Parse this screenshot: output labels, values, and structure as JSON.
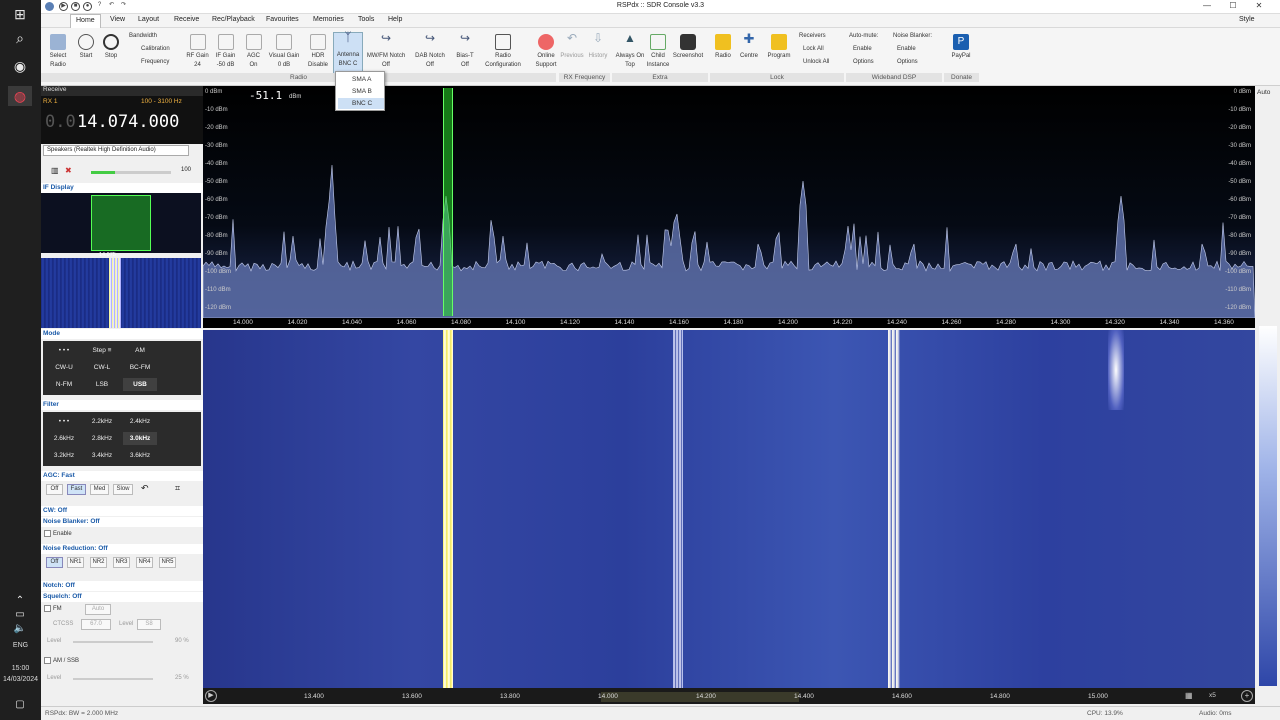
{
  "taskbar": {
    "lang": "ENG",
    "time": "15:00",
    "date": "14/03/2024"
  },
  "window": {
    "title": "RSPdx :: SDR Console v3.3",
    "style_label": "Style"
  },
  "menu": [
    "Home",
    "View",
    "Layout",
    "Receive",
    "Rec/Playback",
    "Favourites",
    "Memories",
    "Tools",
    "Help"
  ],
  "ribbon": {
    "select_radio": "Select Radio",
    "start": "Start",
    "stop": "Stop",
    "bandwidth": "Bandwidth",
    "calibration": "Calibration",
    "frequency": "Frequency",
    "rf_gain": "RF Gain",
    "rf_gain_val": "24",
    "if_gain": "IF Gain",
    "if_gain_val": "-50 dB",
    "agc": "AGC",
    "agc_val": "On",
    "visual_gain": "Visual Gain",
    "visual_gain_val": "0 dB",
    "hdr": "HDR",
    "hdr_val": "Disable",
    "antenna": "Antenna",
    "antenna_val": "BNC C",
    "mwfm_notch": "MW/FM Notch",
    "mwfm_val": "Off",
    "dab_notch": "DAB Notch",
    "dab_val": "Off",
    "bias_t": "Bias-T",
    "bias_val": "Off",
    "radio_config": "Radio Configuration",
    "online_support": "Online Support",
    "previous": "Previous",
    "history": "History",
    "always_on_top": "Always On Top",
    "child_instance": "Child Instance",
    "screenshot": "Screenshot",
    "lock_radio": "Radio",
    "lock_centre": "Centre",
    "lock_program": "Program",
    "receivers": "Receivers",
    "lock_all": "Lock All",
    "unlock_all": "Unlock All",
    "automute": "Auto-mute:",
    "automute_enable": "Enable",
    "automute_options": "Options",
    "noise_blanker": "Noise Blanker:",
    "nb_enable": "Enable",
    "nb_options": "Options",
    "paypal": "PayPal",
    "groups": [
      "Radio",
      "RX Frequency",
      "Extra",
      "Lock",
      "Wideband DSP",
      "Donate"
    ]
  },
  "antenna_dropdown": {
    "items": [
      "SMA A",
      "SMA B",
      "BNC C"
    ],
    "selected": "BNC C"
  },
  "receive": {
    "header": "Receive",
    "rx": "RX 1",
    "bandwidth": "100 - 3100 Hz",
    "freq_prefix": "0.0",
    "freq_main": "14.074.000",
    "audio_device": "Speakers (Realtek High Definition Audio)",
    "volume": "100",
    "if_display": "IF Display",
    "if_freq": "14.075"
  },
  "mode": {
    "title": "Mode",
    "items": [
      "• • •",
      "Step ≡",
      "AM",
      "CW-U",
      "CW-L",
      "BC-FM",
      "N-FM",
      "LSB",
      "USB"
    ],
    "selected": "USB"
  },
  "filter": {
    "title": "Filter",
    "items": [
      "• • •",
      "2.2kHz",
      "2.4kHz",
      "2.6kHz",
      "2.8kHz",
      "3.0kHz",
      "3.2kHz",
      "3.4kHz",
      "3.6kHz"
    ],
    "selected": "3.0kHz"
  },
  "agc": {
    "title": "AGC: Fast",
    "items": [
      "Off",
      "Fast",
      "Med",
      "Slow"
    ],
    "selected": "Fast"
  },
  "cw": {
    "title": "CW: Off"
  },
  "nb": {
    "title": "Noise Blanker: Off",
    "enable": "Enable"
  },
  "nr": {
    "title": "Noise Reduction: Off",
    "items": [
      "Off",
      "NR1",
      "NR2",
      "NR3",
      "NR4",
      "NR5"
    ],
    "selected": "Off"
  },
  "notch": {
    "title": "Notch: Off"
  },
  "squelch": {
    "title": "Squelch: Off",
    "fm": "FM",
    "auto": "Auto",
    "ctcss": "CTCSS",
    "ctcss_val": "67.0",
    "level_lbl": "Level",
    "level_val": "S8",
    "level": "Level",
    "level_pct": "90 %",
    "amssb": "AM / SSB",
    "level2": "Level",
    "level2_pct": "25 %"
  },
  "spectrum": {
    "signal": "-51.1",
    "signal_unit": "dBm",
    "db_labels": [
      "0 dBm",
      "-10 dBm",
      "-20 dBm",
      "-30 dBm",
      "-40 dBm",
      "-50 dBm",
      "-60 dBm",
      "-70 dBm",
      "-80 dBm",
      "-90 dBm",
      "-100 dBm",
      "-110 dBm",
      "-120 dBm"
    ],
    "freq_labels": [
      "14.000",
      "14.020",
      "14.040",
      "14.060",
      "14.080",
      "14.100",
      "14.120",
      "14.140",
      "14.160",
      "14.180",
      "14.200",
      "14.220",
      "14.240",
      "14.260",
      "14.280",
      "14.300",
      "14.320",
      "14.340",
      "14.360"
    ],
    "auto": "Auto"
  },
  "bottom_axis": {
    "labels": [
      "13.400",
      "13.600",
      "13.800",
      "14.000",
      "14.200",
      "14.400",
      "14.600",
      "14.800",
      "15.000"
    ],
    "zoom": "x5"
  },
  "status": {
    "left": "RSPdx: BW = 2.000 MHz",
    "cpu": "CPU: 13.9%",
    "audio": "Audio: 0ms"
  }
}
